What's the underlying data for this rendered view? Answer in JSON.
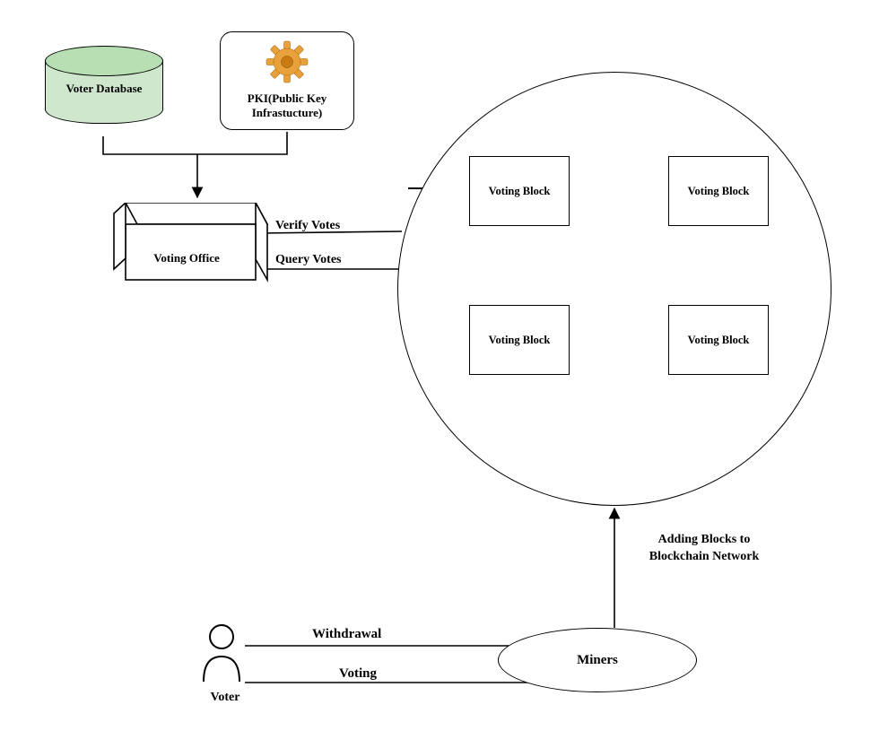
{
  "nodes": {
    "voter_database": "Voter Database",
    "pki": "PKI(Public Key Infrastucture)",
    "voting_office": "Voting Office",
    "voting_block_tl": "Voting Block",
    "voting_block_tr": "Voting Block",
    "voting_block_br": "Voting Block",
    "voting_block_bl": "Voting Block",
    "voter": "Voter",
    "miners": "Miners"
  },
  "edges": {
    "verify_votes": "Verify Votes",
    "query_votes": "Query Votes",
    "withdrawal": "Withdrawal",
    "voting": "Voting",
    "adding_blocks": "Adding Blocks to Blockchain Network"
  },
  "icons": {
    "gear": "gear-icon",
    "person": "person-icon",
    "database": "database-icon"
  },
  "colors": {
    "db_fill": "#cfe8cd",
    "db_top": "#b7dfb3",
    "gear_outer": "#e9a13b",
    "gear_inner": "#c97b12"
  }
}
